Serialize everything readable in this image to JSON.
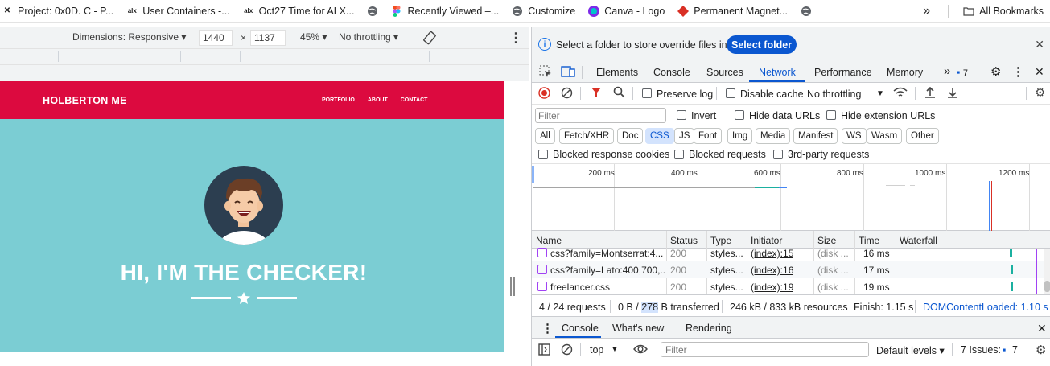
{
  "bookmarks": {
    "items": [
      {
        "icon": "close-icon",
        "label": "Project: 0x0D. C - P..."
      },
      {
        "icon": "alx-logo-icon",
        "label": "User Containers -..."
      },
      {
        "icon": "alx-logo-icon",
        "label": "Oct27 Time for ALX..."
      },
      {
        "icon": "globe-icon",
        "label": ""
      },
      {
        "icon": "figma-icon",
        "label": "Recently Viewed –..."
      },
      {
        "icon": "globe-icon",
        "label": "Customize"
      },
      {
        "icon": "canva-icon",
        "label": "Canva - Logo"
      },
      {
        "icon": "magnet-icon",
        "label": "Permanent Magnet..."
      },
      {
        "icon": "globe-icon",
        "label": ""
      }
    ],
    "more": "»",
    "all_bookmarks": "All Bookmarks"
  },
  "device_toolbar": {
    "dimensions_label": "Dimensions: Responsive ▾",
    "width": "1440",
    "times": "×",
    "height": "1137",
    "zoom": "45% ▾",
    "throttling": "No throttling ▾"
  },
  "preview": {
    "brand": "HOLBERTON ME",
    "nav": [
      "PORTFOLIO",
      "ABOUT",
      "CONTACT"
    ],
    "hero_title": "HI, I'M THE CHECKER!",
    "colors": {
      "nav": "#dc0a3f",
      "hero": "#7bcdd3",
      "avatar_bg": "#2c3e50"
    }
  },
  "devtools": {
    "info_text": "Select a folder to store override files in.",
    "select_folder": "Select folder",
    "tabs": [
      "Elements",
      "Console",
      "Sources",
      "Network",
      "Performance",
      "Memory"
    ],
    "active_tab": "Network",
    "more_tabs": "»",
    "issues_count": "7",
    "toolbar": {
      "preserve_log": "Preserve log",
      "disable_cache": "Disable cache",
      "throttling": "No throttling"
    },
    "filter": {
      "placeholder": "Filter",
      "invert": "Invert",
      "hide_data_urls": "Hide data URLs",
      "hide_extension_urls": "Hide extension URLs"
    },
    "types": [
      "All",
      "Fetch/XHR",
      "Doc",
      "CSS",
      "JS",
      "Font",
      "Img",
      "Media",
      "Manifest",
      "WS",
      "Wasm",
      "Other"
    ],
    "active_type": "CSS",
    "blocked": {
      "cookies": "Blocked response cookies",
      "requests": "Blocked requests",
      "third_party": "3rd-party requests"
    },
    "timeline_labels": [
      "200 ms",
      "400 ms",
      "600 ms",
      "800 ms",
      "1000 ms",
      "1200 ms"
    ],
    "table": {
      "headers": [
        "Name",
        "Status",
        "Type",
        "Initiator",
        "Size",
        "Time",
        "Waterfall"
      ],
      "rows": [
        {
          "name": "css?family=Montserrat:4...",
          "status": "200",
          "type": "styles...",
          "initiator": "(index):15",
          "size": "(disk ...",
          "time": "16 ms"
        },
        {
          "name": "css?family=Lato:400,700,...",
          "status": "200",
          "type": "styles...",
          "initiator": "(index):16",
          "size": "(disk ...",
          "time": "17 ms"
        },
        {
          "name": "freelancer.css",
          "status": "200",
          "type": "styles...",
          "initiator": "(index):19",
          "size": "(disk ...",
          "time": "19 ms"
        }
      ]
    },
    "status": {
      "requests": "4 / 24 requests",
      "transferred_a": "0 B / ",
      "transferred_b": "278",
      "transferred_c": " B transferred",
      "resources": "246 kB / 833 kB resources",
      "finish": "Finish: 1.15 s",
      "dom_loaded": "DOMContentLoaded: 1.10 s"
    },
    "console": {
      "tabs": [
        "Console",
        "What's new",
        "Rendering"
      ],
      "context": "top",
      "filter_placeholder": "Filter",
      "levels": "Default levels ▾",
      "issues_label": "7 Issues:",
      "issues_count": "7"
    }
  }
}
